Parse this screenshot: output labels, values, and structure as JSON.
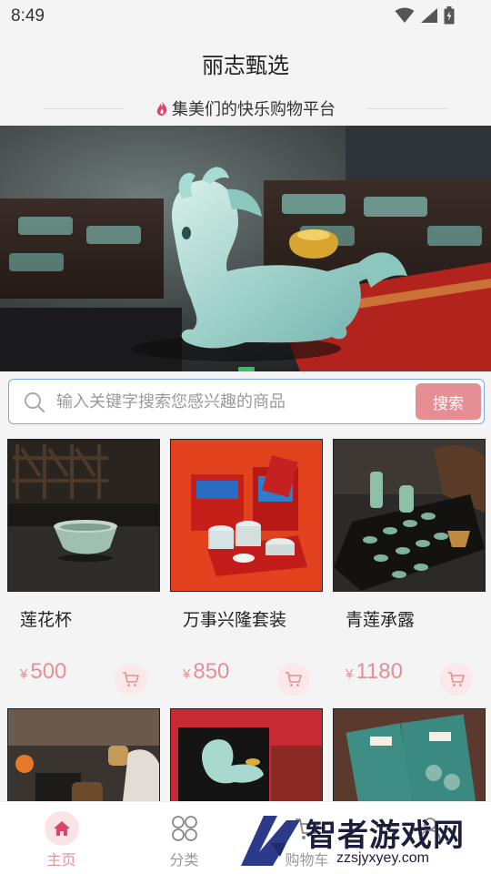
{
  "status_bar": {
    "time": "8:49"
  },
  "app": {
    "title": "丽志甄选",
    "slogan": "集美们的快乐购物平台"
  },
  "search": {
    "placeholder": "输入关键字搜索您感兴趣的商品",
    "value": "",
    "button_label": "搜索"
  },
  "products": [
    {
      "name": "莲花杯",
      "currency": "¥",
      "price": "500"
    },
    {
      "name": "万事兴隆套装",
      "currency": "¥",
      "price": "850"
    },
    {
      "name": "青莲承露",
      "currency": "¥",
      "price": "1180"
    }
  ],
  "tabbar": {
    "items": [
      {
        "label": "主页",
        "icon": "home-icon",
        "active": true
      },
      {
        "label": "分类",
        "icon": "category-icon",
        "active": false
      },
      {
        "label": "购物车",
        "icon": "cart-icon",
        "active": false
      },
      {
        "label": "",
        "icon": "user-icon",
        "active": false
      }
    ]
  },
  "watermark": {
    "text": "智者游戏网",
    "url": "zzsjyxyey.com"
  },
  "colors": {
    "accent": "#e58f95",
    "search_border": "#7fa8d8",
    "indicator": "#33c35a"
  }
}
